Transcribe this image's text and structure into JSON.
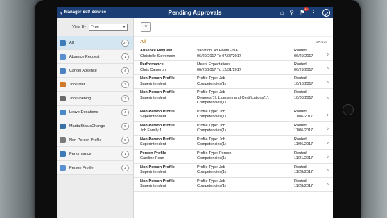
{
  "header": {
    "back_label": "Manager Self Service",
    "title": "Pending Approvals",
    "notification_count": "13"
  },
  "sidebar": {
    "view_by_label": "View By",
    "view_by_value": "Type",
    "items": [
      {
        "label": "All",
        "count": "27",
        "icon": "globe-icon",
        "color": "#3d7ab8",
        "active": true
      },
      {
        "label": "Absence Request",
        "count": "1",
        "icon": "calendar-icon",
        "color": "#5a8fd0"
      },
      {
        "label": "Cancel Absence",
        "count": "4",
        "icon": "cancel-absence-icon",
        "color": "#4b83c0"
      },
      {
        "label": "Job Offer",
        "count": "2",
        "icon": "job-offer-icon",
        "color": "#d37a2a"
      },
      {
        "label": "Job Opening",
        "count": "3",
        "icon": "job-opening-icon",
        "color": "#6a6a6a"
      },
      {
        "label": "Leave Donations",
        "count": "4",
        "icon": "leave-donation-icon",
        "color": "#4c89c7"
      },
      {
        "label": "MaritalStatusChange",
        "count": "5",
        "icon": "marital-status-icon",
        "color": "#3a6fa8"
      },
      {
        "label": "Non-Person Profile",
        "count": "5",
        "icon": "non-person-profile-icon",
        "color": "#7a7a7a"
      },
      {
        "label": "Performance",
        "count": "1",
        "icon": "performance-chart-icon",
        "color": "#3d7ab8"
      },
      {
        "label": "Person Profile",
        "count": "2",
        "icon": "person-profile-icon",
        "color": "#5a8fd0"
      }
    ]
  },
  "main": {
    "list_title": "All",
    "row_count": "27 rows",
    "rows": [
      {
        "type": "Absence Request",
        "name": "Christelle Stevenson",
        "desc": [
          "Vacation, 48 Hours - NA",
          "06/29/2017 To 07/07/2017"
        ],
        "status": "Routed",
        "date": "06/29/2017"
      },
      {
        "type": "Performance",
        "name": "Chris Cameron",
        "desc": [
          "Meets Expectations",
          "06/28/2017 To 12/31/2017"
        ],
        "status": "Routed",
        "date": "06/29/2017"
      },
      {
        "type": "Non-Person Profile",
        "name": "Superintendent",
        "desc": [
          "Profile Type: Job",
          "Competencies(1)"
        ],
        "status": "Routed",
        "date": "10/16/2017"
      },
      {
        "type": "Non-Person Profile",
        "name": "Superintendent",
        "desc": [
          "Profile Type: Job",
          "Degrees(1), Licenses and Certifications(1),",
          "Competencies(1)"
        ],
        "status": "Routed",
        "date": "10/30/2017"
      },
      {
        "type": "Non-Person Profile",
        "name": "Superintendent",
        "desc": [
          "Profile Type: Job",
          "Competencies(1)"
        ],
        "status": "Routed",
        "date": "11/06/2017"
      },
      {
        "type": "Non-Person Profile",
        "name": "Job Family 1",
        "desc": [
          "Profile Type: Job",
          "Competencies(1)"
        ],
        "status": "Routed",
        "date": "11/06/2017"
      },
      {
        "type": "Non-Person Profile",
        "name": "Superintendent",
        "desc": [
          "Profile Type: Job",
          "Competencies(1)"
        ],
        "status": "Routed",
        "date": "11/06/2017"
      },
      {
        "type": "Person Profile",
        "name": "Caroline Fean",
        "desc": [
          "Profile Type: Person",
          "Competencies(1)"
        ],
        "status": "Routed",
        "date": "11/21/2017"
      },
      {
        "type": "Non-Person Profile",
        "name": "Superintendent",
        "desc": [
          "Profile Type: Job",
          "Competencies(1)"
        ],
        "status": "Routed",
        "date": "11/28/2017"
      },
      {
        "type": "Non-Person Profile",
        "name": "Superintendent",
        "desc": [
          "Profile Type: Job",
          "Competencies(1)"
        ],
        "status": "Routed",
        "date": "11/28/2017"
      }
    ]
  }
}
